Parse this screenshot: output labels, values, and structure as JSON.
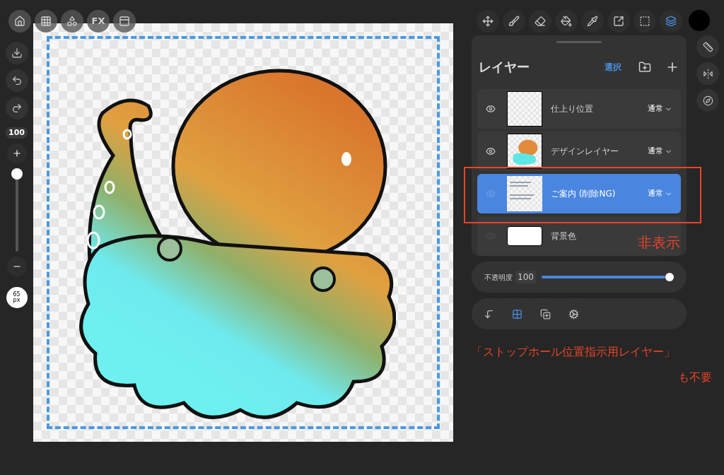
{
  "top_left_tools": [
    {
      "kind": "home"
    },
    {
      "kind": "grid"
    },
    {
      "kind": "shapes"
    },
    {
      "kind": "fx",
      "label": "FX"
    },
    {
      "kind": "window"
    }
  ],
  "left_toolbar": {
    "size": "100",
    "brush_size": "65",
    "brush_unit": "px",
    "level": 1
  },
  "tools": [
    {
      "kind": "move",
      "selected": false
    },
    {
      "kind": "brush",
      "selected": false
    },
    {
      "kind": "eraser",
      "selected": false
    },
    {
      "kind": "fill",
      "selected": false
    },
    {
      "kind": "picker",
      "selected": false
    },
    {
      "kind": "transform",
      "selected": false
    },
    {
      "kind": "select",
      "selected": false
    },
    {
      "kind": "layers",
      "selected": true
    }
  ],
  "layers_panel": {
    "title": "レイヤー",
    "select_label": "選択",
    "layers": [
      {
        "name": "仕上り位置",
        "blend": "通常",
        "visible": true,
        "selected": false,
        "kind": "transparent"
      },
      {
        "name": "デザインレイヤー",
        "blend": "通常",
        "visible": true,
        "selected": false,
        "kind": "design"
      },
      {
        "name": "ご案内 (削除NG)",
        "blend": "通常",
        "visible": false,
        "selected": true,
        "kind": "text"
      },
      {
        "name": "背景色",
        "visible": false,
        "selected": false,
        "kind": "white"
      }
    ]
  },
  "opacity": {
    "label": "不透明度",
    "value": "100",
    "level": 1
  },
  "annotations": {
    "hidden_note": "非表示",
    "layer_note": "「ストップホール位置指示用レイヤー」",
    "layer_note_2": "も不要"
  }
}
